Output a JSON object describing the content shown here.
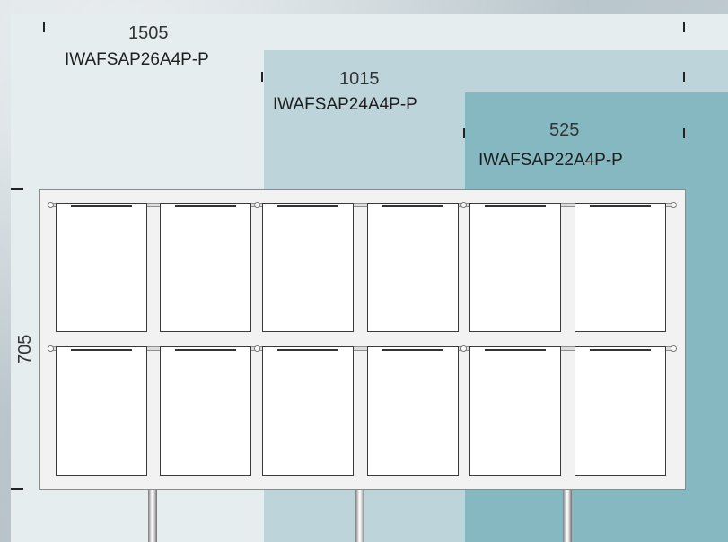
{
  "models": [
    {
      "width": "1505",
      "code": "IWAFSAP26A4P-P"
    },
    {
      "width": "1015",
      "code": "IWAFSAP24A4P-P"
    },
    {
      "width": "525",
      "code": "IWAFSAP22A4P-P"
    }
  ],
  "height": "705",
  "colors": {
    "zone_1505": "#e5edef",
    "zone_1015": "#bcd4da",
    "zone_525": "#86b8c2",
    "board": "#f2f2f2",
    "pocket": "#ffffff"
  },
  "board": {
    "rows": 2,
    "columns": 6,
    "posts": 3
  }
}
